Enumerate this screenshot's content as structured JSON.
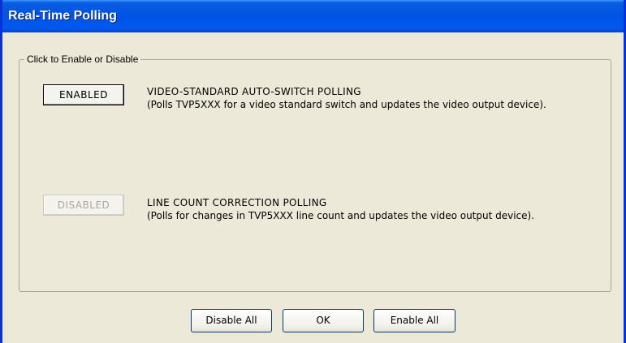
{
  "window": {
    "title": "Real-Time Polling"
  },
  "group": {
    "legend": "Click to Enable or Disable",
    "rows": [
      {
        "button_label": "ENABLED",
        "state": "enabled",
        "title": "VIDEO-STANDARD AUTO-SWITCH POLLING",
        "description": "(Polls TVP5XXX for a video standard switch and updates the video output device)."
      },
      {
        "button_label": "DISABLED",
        "state": "disabled",
        "title": "LINE COUNT CORRECTION POLLING",
        "description": "(Polls for changes in TVP5XXX line count and updates the video output device)."
      }
    ]
  },
  "footer": {
    "disable_all_label": "Disable All",
    "ok_label": "OK",
    "enable_all_label": "Enable All"
  },
  "colors": {
    "titlebar": "#0054e3",
    "window_bg": "#ece9d8",
    "disabled_text": "#aca899"
  }
}
